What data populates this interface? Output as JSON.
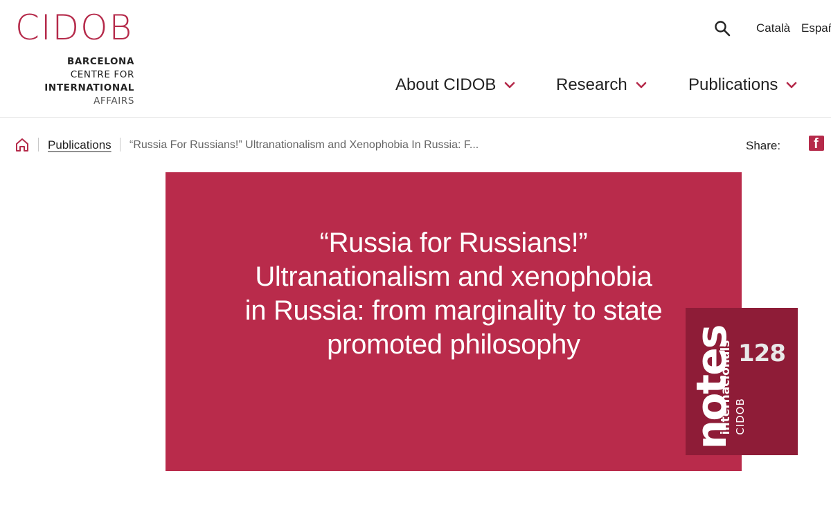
{
  "header": {
    "logo": {
      "mark": "CIDOB",
      "line1": "BARCELONA",
      "line2": "CENTRE FOR",
      "line3": "INTERNATIONAL",
      "line4": "AFFAIRS"
    },
    "languages": [
      "Català",
      "Españ"
    ],
    "nav": [
      "About CIDOB",
      "Research",
      "Publications"
    ],
    "accent_color": "#b52a4a"
  },
  "breadcrumb": {
    "link": "Publications",
    "current": "“Russia For Russians!” Ultranationalism and Xenophobia In Russia: F...",
    "share_label": "Share:"
  },
  "hero": {
    "title": "“Russia for Russians!” Ultranationalism and xenophobia in Russia: from marginality to state promoted philosophy",
    "background_color": "#b92b4b"
  },
  "badge": {
    "word": "notes",
    "subtitle": "internacionals",
    "brand": "CIDOB",
    "number": "128",
    "background_color": "#8e1c37"
  }
}
